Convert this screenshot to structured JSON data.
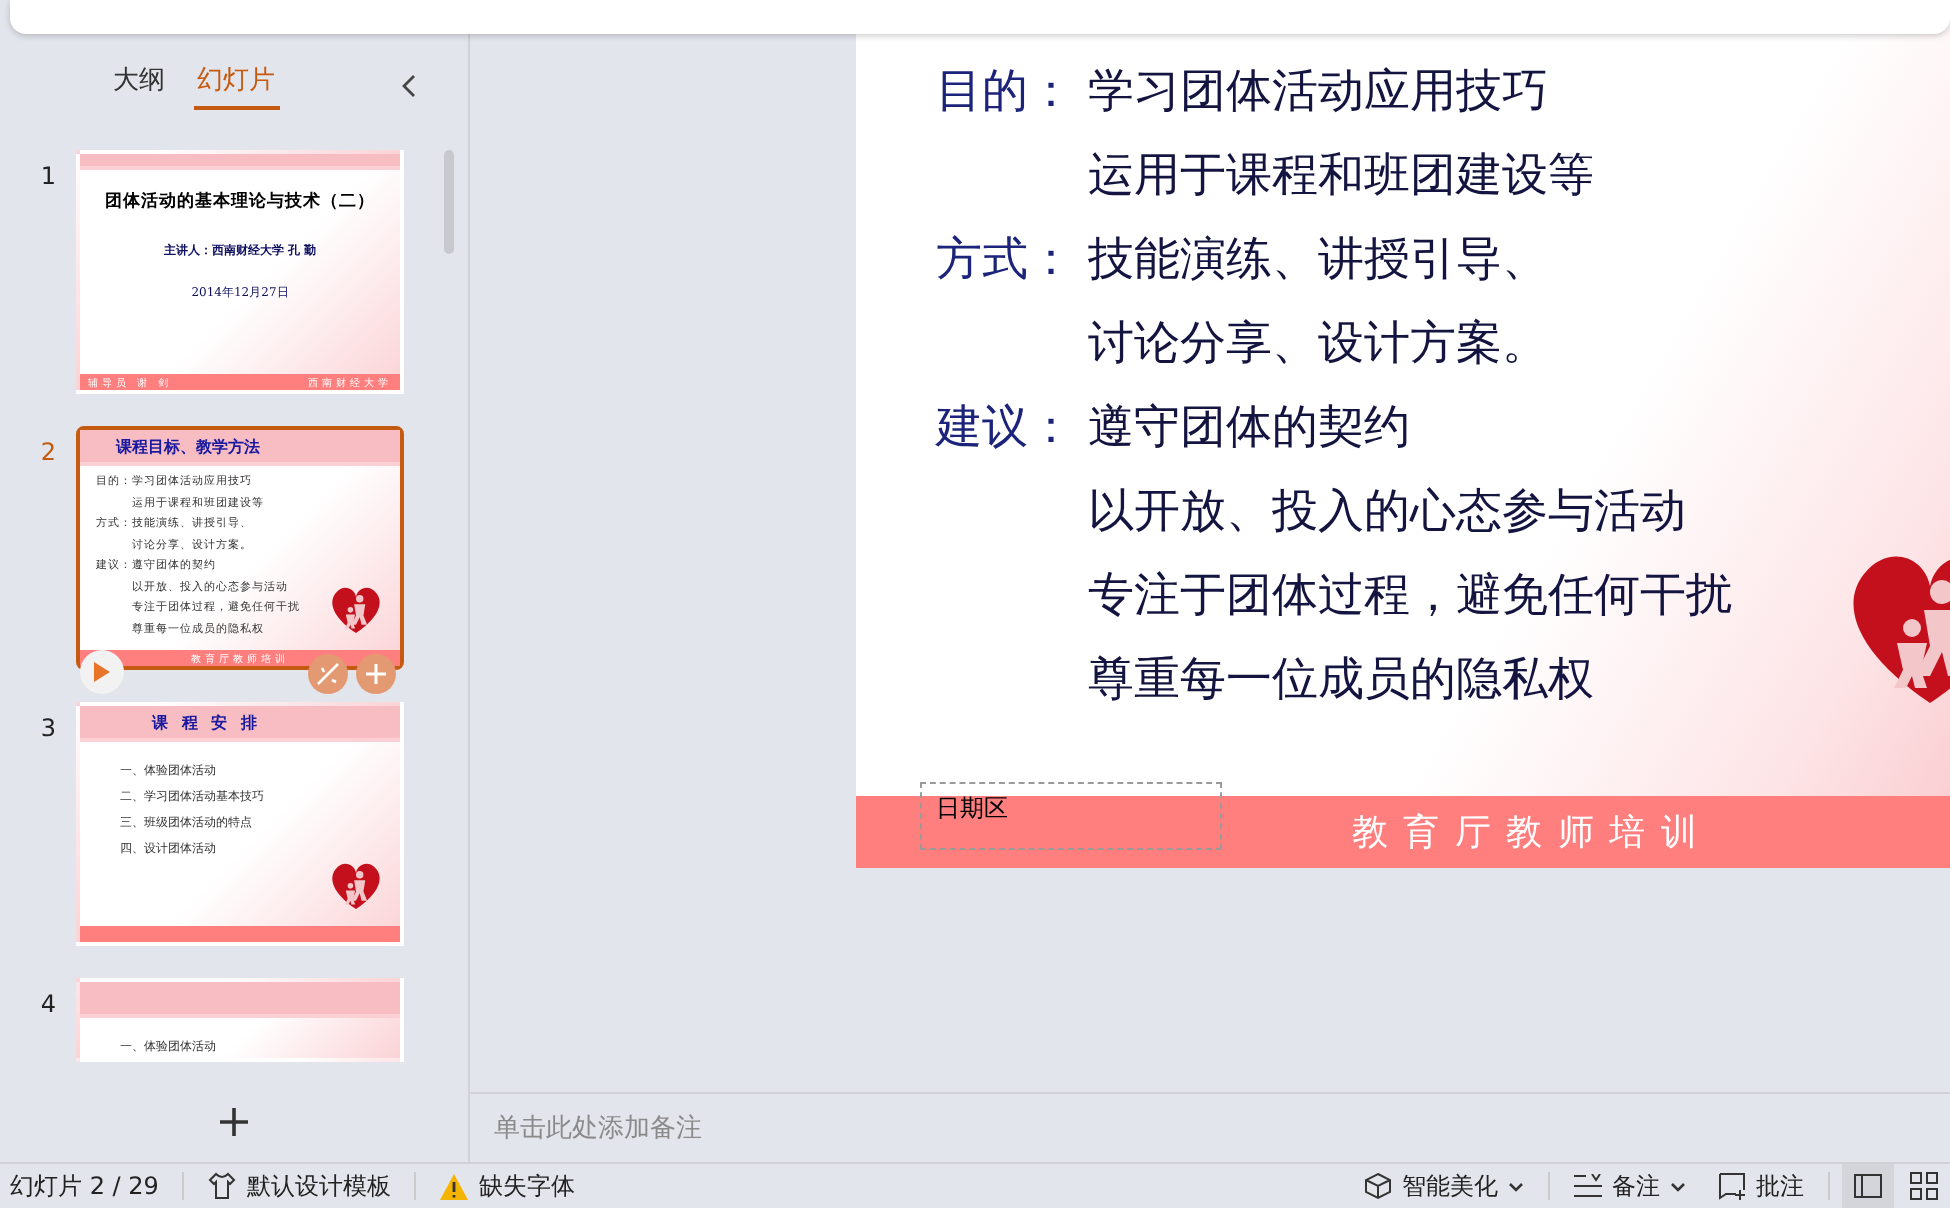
{
  "panel_tabs": [
    {
      "label": "大纲",
      "selected": false
    },
    {
      "label": "幻灯片",
      "selected": true
    }
  ],
  "thumbnails": [
    {
      "number": "1",
      "selected": false,
      "kind": "title",
      "title": "团体活动的基本理论与技术（二）",
      "presenter": "主讲人：西南财经大学 孔 勤",
      "date": "2014年12月27日",
      "footer_left": "辅导员 谢 剑",
      "footer_right": "西南财经大学"
    },
    {
      "number": "2",
      "selected": true,
      "kind": "content",
      "title": "课程目标、教学方法",
      "lines": [
        "目的：学习团体活动应用技巧",
        "　　　运用于课程和班团建设等",
        "方式：技能演练、讲授引导、",
        "　　　讨论分享、设计方案。",
        "建议：遵守团体的契约",
        "　　　以开放、投入的心态参与活动",
        "　　　专注于团体过程，避免任何干扰",
        "　　　尊重每一位成员的隐私权"
      ],
      "footer": "教育厅教师培训"
    },
    {
      "number": "3",
      "selected": false,
      "kind": "list",
      "title": "课 程 安 排",
      "lines": [
        "一、体验团体活动",
        "二、学习团体活动基本技巧",
        "三、班级团体活动的特点",
        "四、设计团体活动"
      ]
    },
    {
      "number": "4",
      "selected": false,
      "kind": "list",
      "lines": [
        "一、体验团体活动"
      ]
    }
  ],
  "slide": {
    "rows": [
      {
        "label": "目的：",
        "text": "学习团体活动应用技巧"
      },
      {
        "text": "运用于课程和班团建设等"
      },
      {
        "label": "方式：",
        "text": "技能演练、讲授引导、"
      },
      {
        "text": "讨论分享、设计方案。"
      },
      {
        "label": "建议：",
        "text": "遵守团体的契约"
      },
      {
        "text": "以开放、投入的心态参与活动"
      },
      {
        "text": "专注于团体过程，避免任何干扰"
      },
      {
        "text": "尊重每一位成员的隐私权"
      }
    ],
    "date_placeholder": "日期区",
    "footer": "教 育 厅 教 师 培 训"
  },
  "notes_placeholder": "单击此处添加备注",
  "status_bar": {
    "slide_counter": "幻灯片 2 / 29",
    "template": "默认设计模板",
    "missing_fonts": "缺失字体",
    "beautify": "智能美化",
    "notes": "备注",
    "comments": "批注",
    "views": [
      {
        "kind": "normal",
        "selected": true
      },
      {
        "kind": "sorter",
        "selected": false
      }
    ]
  }
}
